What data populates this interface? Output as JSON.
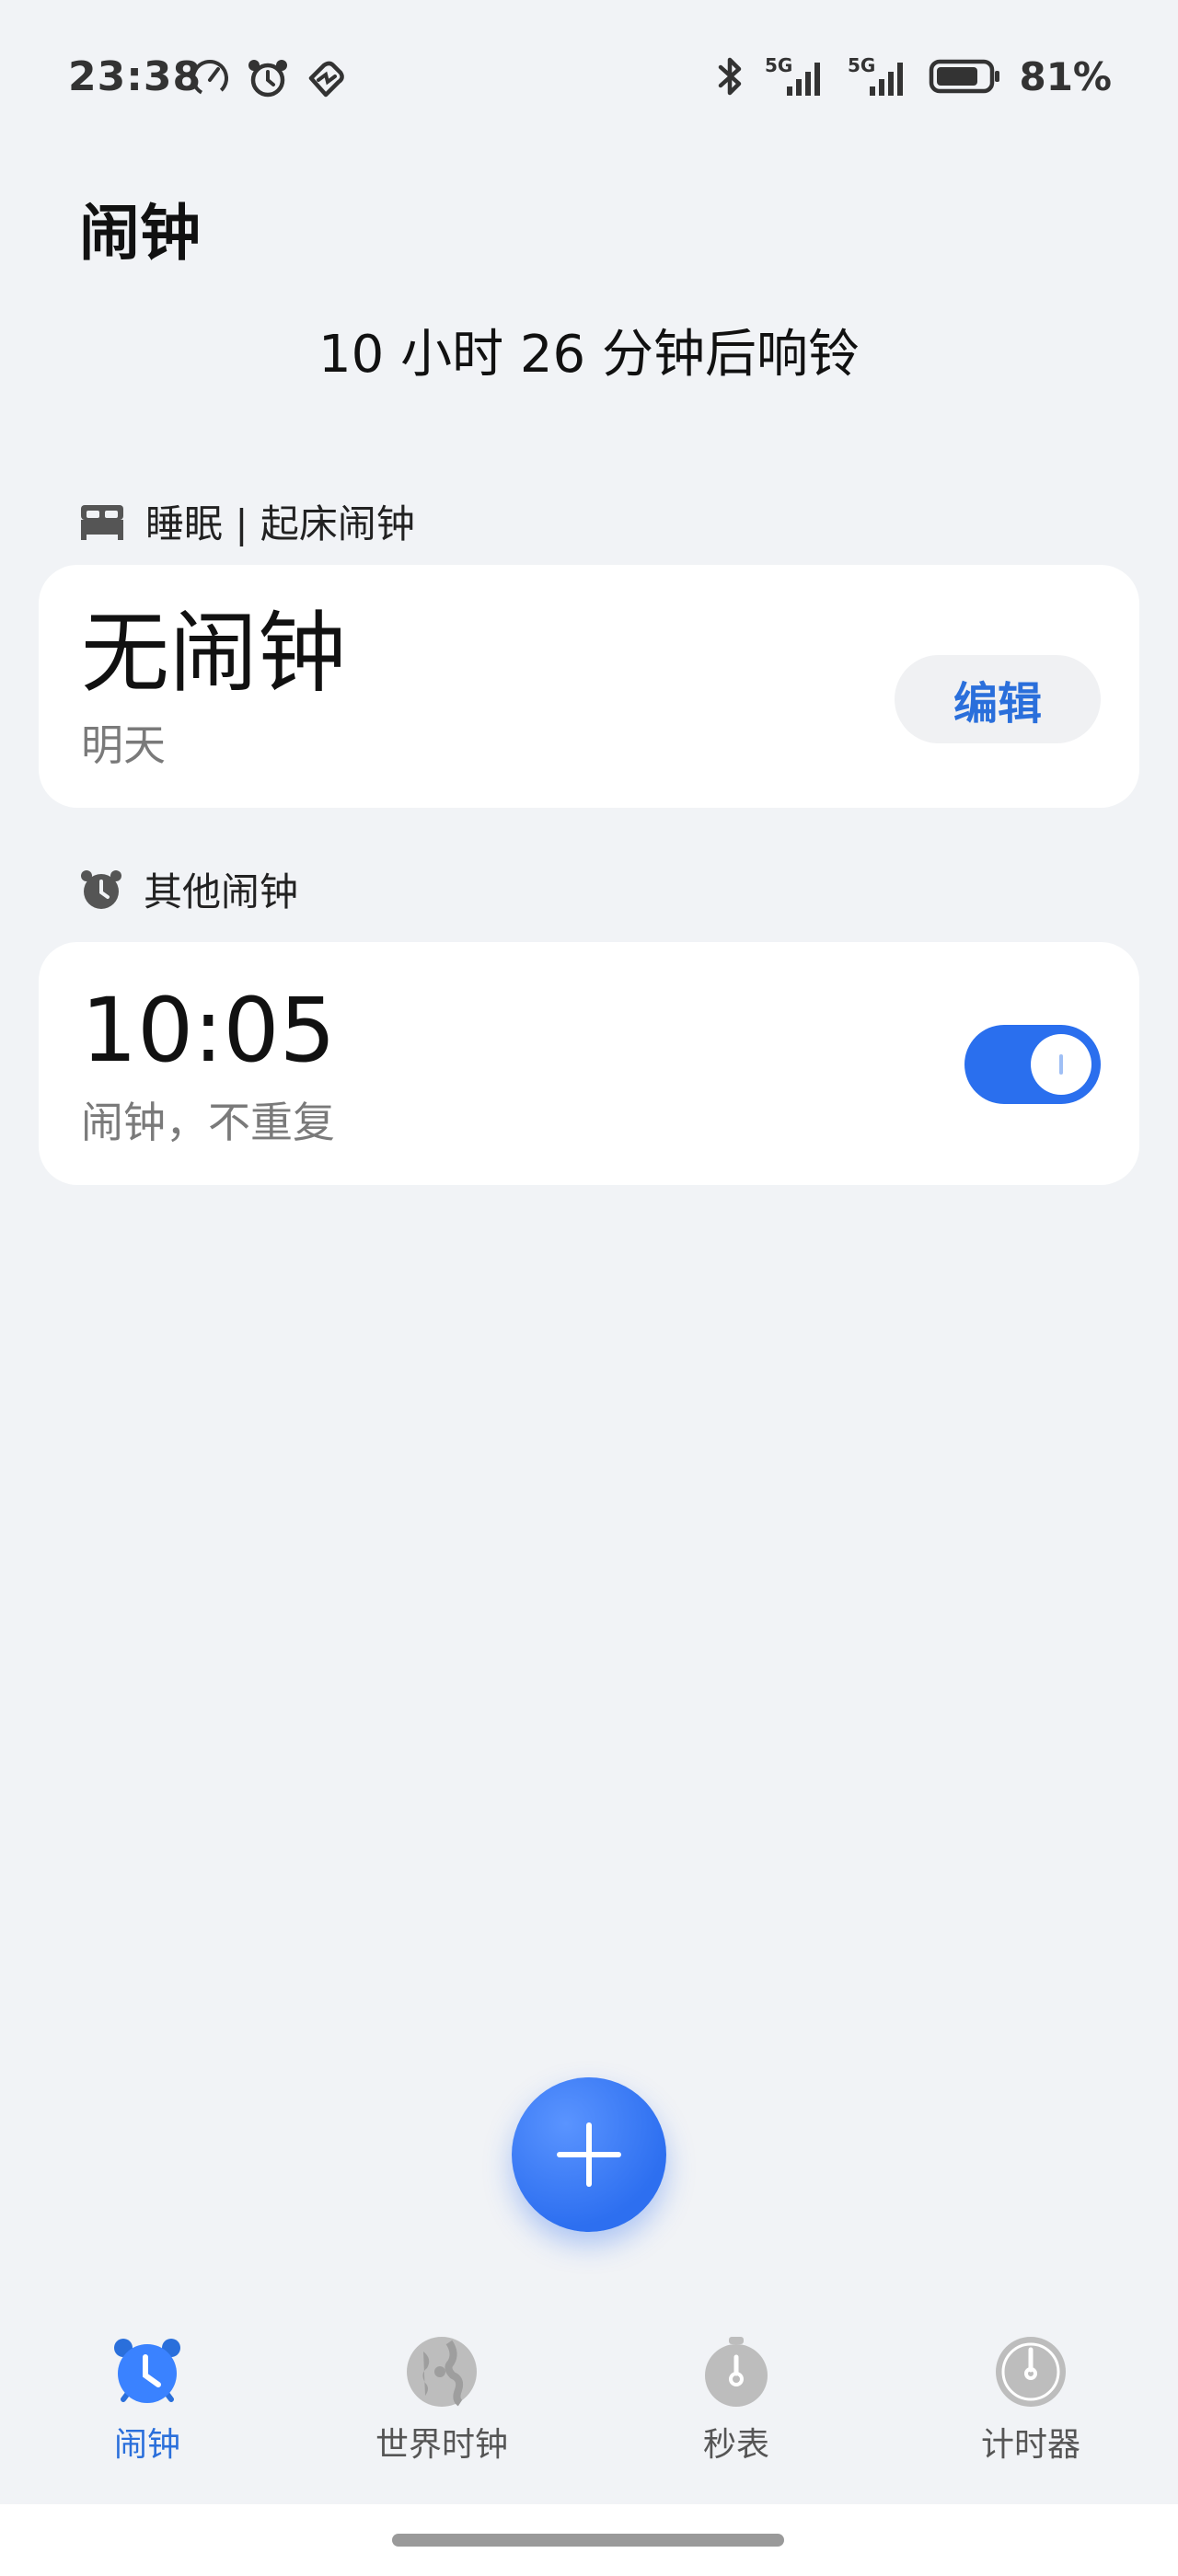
{
  "status_bar": {
    "time": "23:38",
    "left_icons": [
      "speedometer-icon",
      "alarm-icon",
      "health-heart-icon"
    ],
    "right_icons": [
      "bluetooth-icon",
      "signal-5g-sim1-icon",
      "signal-5g-sim2-icon",
      "battery-icon"
    ],
    "network_label_1": "5G",
    "network_label_2": "5G",
    "battery_level": 0.81,
    "battery_text": "81%"
  },
  "header": {
    "title": "闹钟",
    "next_ring": "10 小时 26 分钟后响铃"
  },
  "sleep_section": {
    "icon": "bed-icon",
    "label": "睡眠 | 起床闹钟",
    "card": {
      "main_text": "无闹钟",
      "sub_text": "明天",
      "edit_label": "编辑"
    }
  },
  "other_section": {
    "icon": "alarm-clock-icon",
    "label": "其他闹钟",
    "alarms": [
      {
        "time": "10:05",
        "description": "闹钟，不重复",
        "enabled": true
      }
    ]
  },
  "fab": {
    "icon": "plus-icon"
  },
  "bottom_nav": {
    "items": [
      {
        "label": "闹钟",
        "icon": "alarm-clock-icon",
        "active": true
      },
      {
        "label": "世界时钟",
        "icon": "globe-icon",
        "active": false
      },
      {
        "label": "秒表",
        "icon": "stopwatch-icon",
        "active": false
      },
      {
        "label": "计时器",
        "icon": "timer-icon",
        "active": false
      }
    ]
  },
  "colors": {
    "accent": "#2a6fdb",
    "toggle_on": "#2a6fee",
    "background": "#f1f3f6",
    "card": "#ffffff",
    "inactive_icon": "#bdbdbd"
  }
}
